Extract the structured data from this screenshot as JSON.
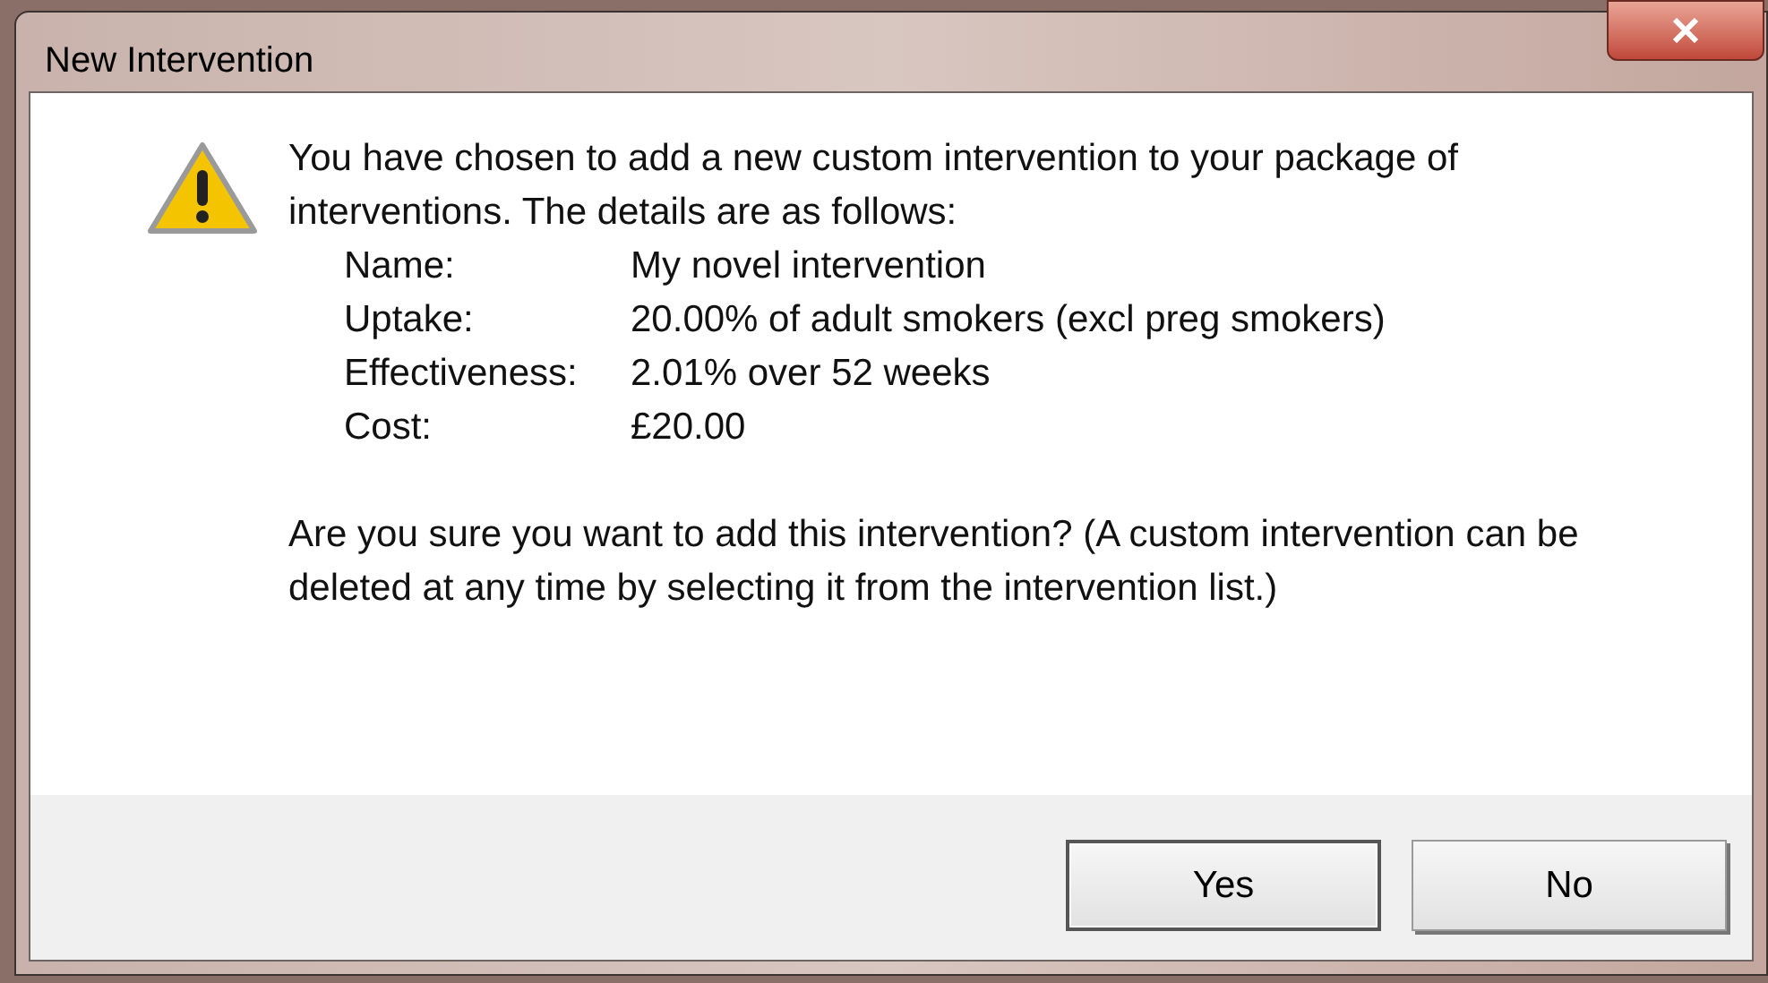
{
  "window": {
    "title": "New Intervention"
  },
  "message": {
    "intro": "You have chosen to add a new custom intervention to your package of interventions. The details are as follows:",
    "details": [
      {
        "label": "Name:",
        "value": "My novel intervention"
      },
      {
        "label": "Uptake:",
        "value": "20.00% of adult smokers (excl preg smokers)"
      },
      {
        "label": "Effectiveness:",
        "value": "2.01% over 52 weeks"
      },
      {
        "label": "Cost:",
        "value": "£20.00"
      }
    ],
    "question": "Are you sure you want to add this intervention? (A custom intervention can be deleted at any time by selecting it from the intervention list.)"
  },
  "buttons": [
    {
      "label": "Yes",
      "default": true
    },
    {
      "label": "No",
      "default": false
    }
  ]
}
